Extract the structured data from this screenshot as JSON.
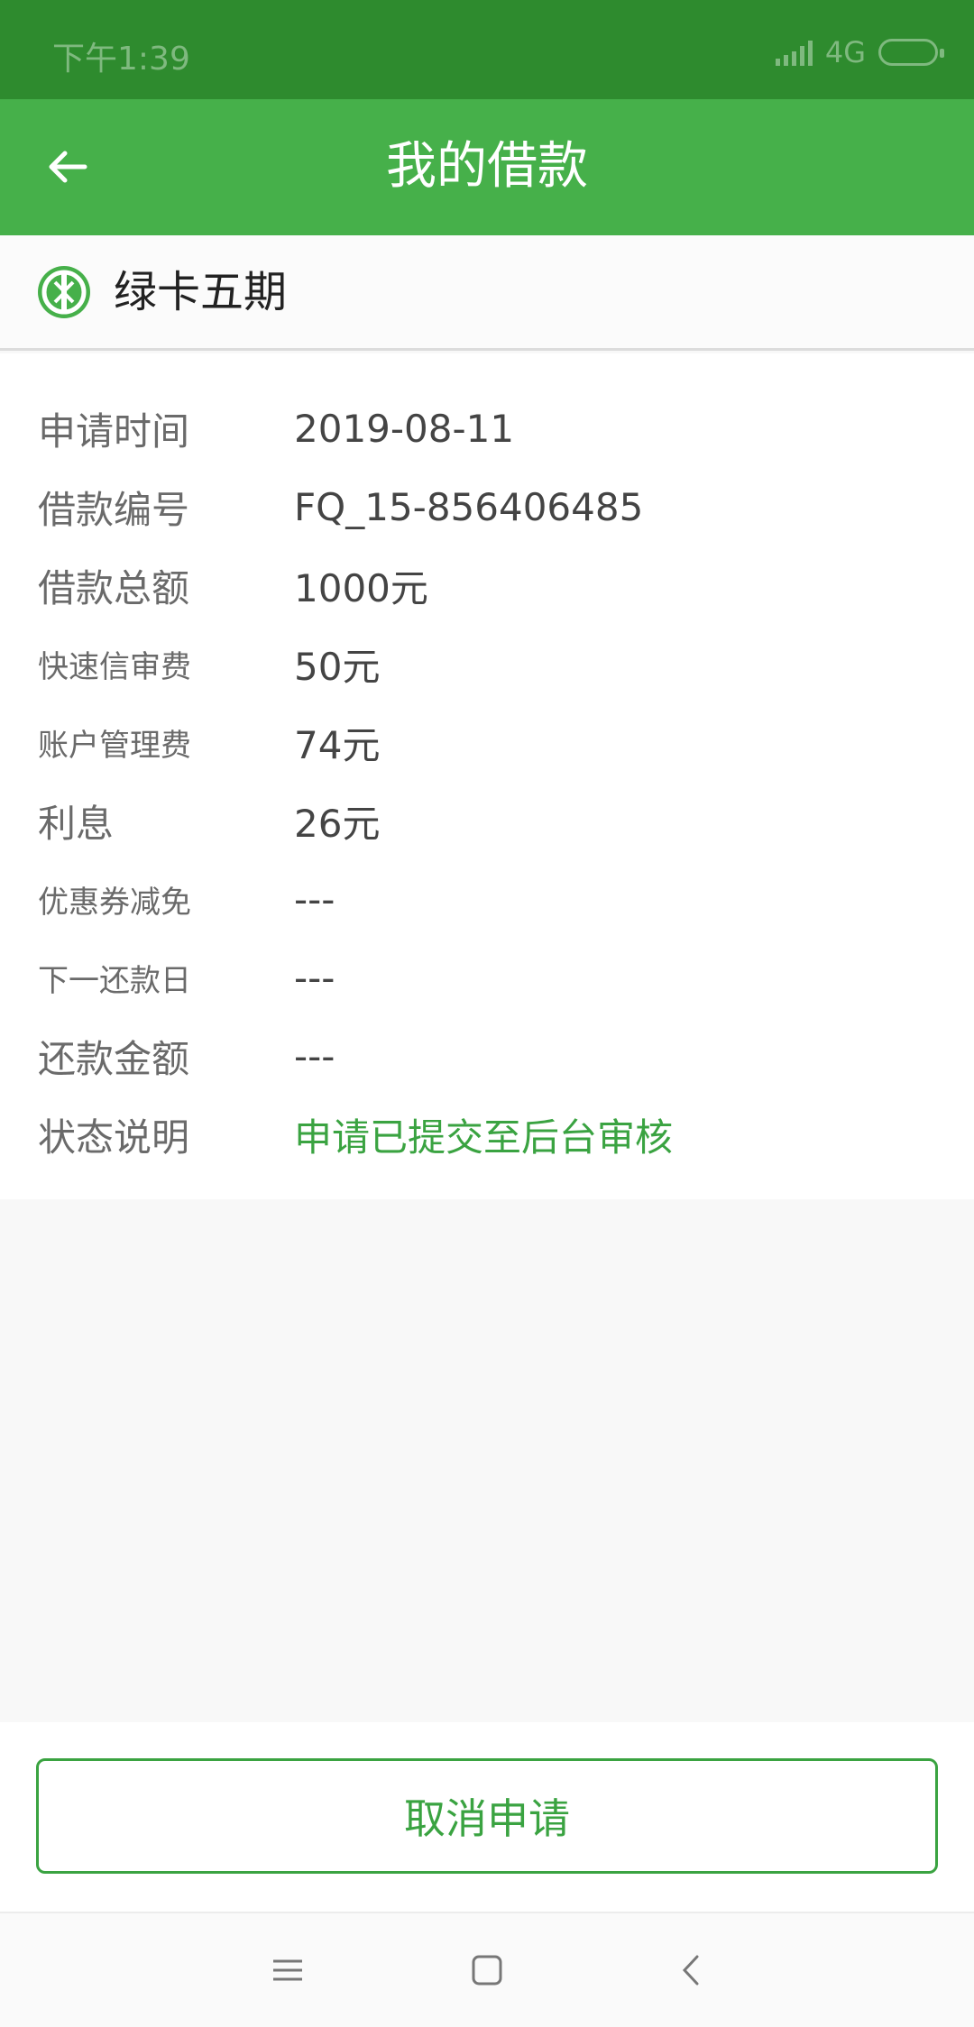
{
  "status": {
    "time": "下午1:39",
    "network": "4G"
  },
  "header": {
    "title": "我的借款",
    "back_icon": "arrow-left-icon"
  },
  "product": {
    "name": "绿卡五期",
    "logo_icon": "green-card-logo"
  },
  "details": [
    {
      "label": "申请时间",
      "value": "2019-08-11"
    },
    {
      "label": "借款编号",
      "value": "FQ_15-856406485"
    },
    {
      "label": "借款总额",
      "value": "1000元"
    },
    {
      "label": "快速信审费",
      "value": "50元"
    },
    {
      "label": "账户管理费",
      "value": "74元"
    },
    {
      "label": "利息",
      "value": "26元"
    },
    {
      "label": "优惠券减免",
      "value": "---"
    },
    {
      "label": "下一还款日",
      "value": "---"
    },
    {
      "label": "还款金额",
      "value": "---"
    },
    {
      "label": "状态说明",
      "value": "申请已提交至后台审核"
    }
  ],
  "cancel_button": {
    "label": "取消申请"
  },
  "colors": {
    "status_bar": "#2e8b2e",
    "header": "#46b04a",
    "accent": "#3aa341"
  }
}
